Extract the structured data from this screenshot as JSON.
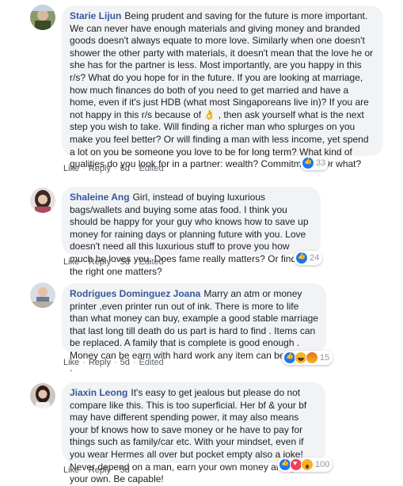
{
  "comments": [
    {
      "author": "Starie Lijun",
      "text": "Being prudent and saving for the future is more important. We can never have enough materials and giving money and branded goods doesn't always equate to more love. Similarly when one doesn't shower the other party with materials, it doesn't mean that the love he or she has for the partner is less. Most importantly, are you happy in this r/s? What do you hope for in the future. If you are looking at marriage, how much finances do both of you need to get married and have a home, even if it's just HDB (what most Singaporeans live in)? If you are not happy in this r/s because of 👌 , then ask yourself what is the next step you wish to take. Will finding a richer man who splurges on you make you feel better? Or will finding a man with less income, yet spend a lot on you be someone you love to be for long term? What kind of qualities do you look for in a partner: wealth? Commitment? Or what?",
      "like": "Like",
      "reply": "Reply",
      "time": "5d",
      "edited": "Edited",
      "reaction_count": "33",
      "reactions": [
        "like-icon"
      ]
    },
    {
      "author": "Shaleine Ang",
      "text": "Girl, instead of buying luxurious bags/wallets and buying some atas food. I think you should be happy for your guy who knows how to save up money for raining days or planning future with you. Love doesn't need all this luxurious stuff to prove you how much he loves you. Does fame really matters? Or finding the right one matters?",
      "like": "Like",
      "reply": "Reply",
      "time": "5d",
      "edited": "Edited",
      "reaction_count": "24",
      "reactions": [
        "like-icon"
      ]
    },
    {
      "author": "Rodrigues Dominguez Joana",
      "text": "Marry an atm or money printer ,even printer run out of ink. There is more to life than what money can buy, example a good stable marriage that last long till death do us part is hard to find . Items can be replaced. A family that is complete is good enough . Money can be earn with hard work any item can be bought .",
      "like": "Like",
      "reply": "Reply",
      "time": "5d",
      "edited": "Edited",
      "reaction_count": "15",
      "reactions": [
        "like-icon",
        "haha-icon",
        "angry-icon"
      ]
    },
    {
      "author": "Jiaxin Leong",
      "text": "It's easy to get jealous but please do not compare like this. This is too superficial. Her bf & your bf may have different spending power, it may also means your bf knows how to save money or he have to pay for things such as family/car etc. With your mindset, even if you wear Hermes all over but pocket empty also a joke! Never depend on a man, earn your own money and get your own. Be capable!",
      "like": "Like",
      "reply": "Reply",
      "time": "5d",
      "edited": "",
      "reaction_count": "100",
      "reactions": [
        "like-icon",
        "love-icon",
        "wow-icon"
      ]
    }
  ],
  "colors": {
    "author": "#385898",
    "bubble": "#f2f3f5",
    "like_blue": "#1877f2"
  }
}
